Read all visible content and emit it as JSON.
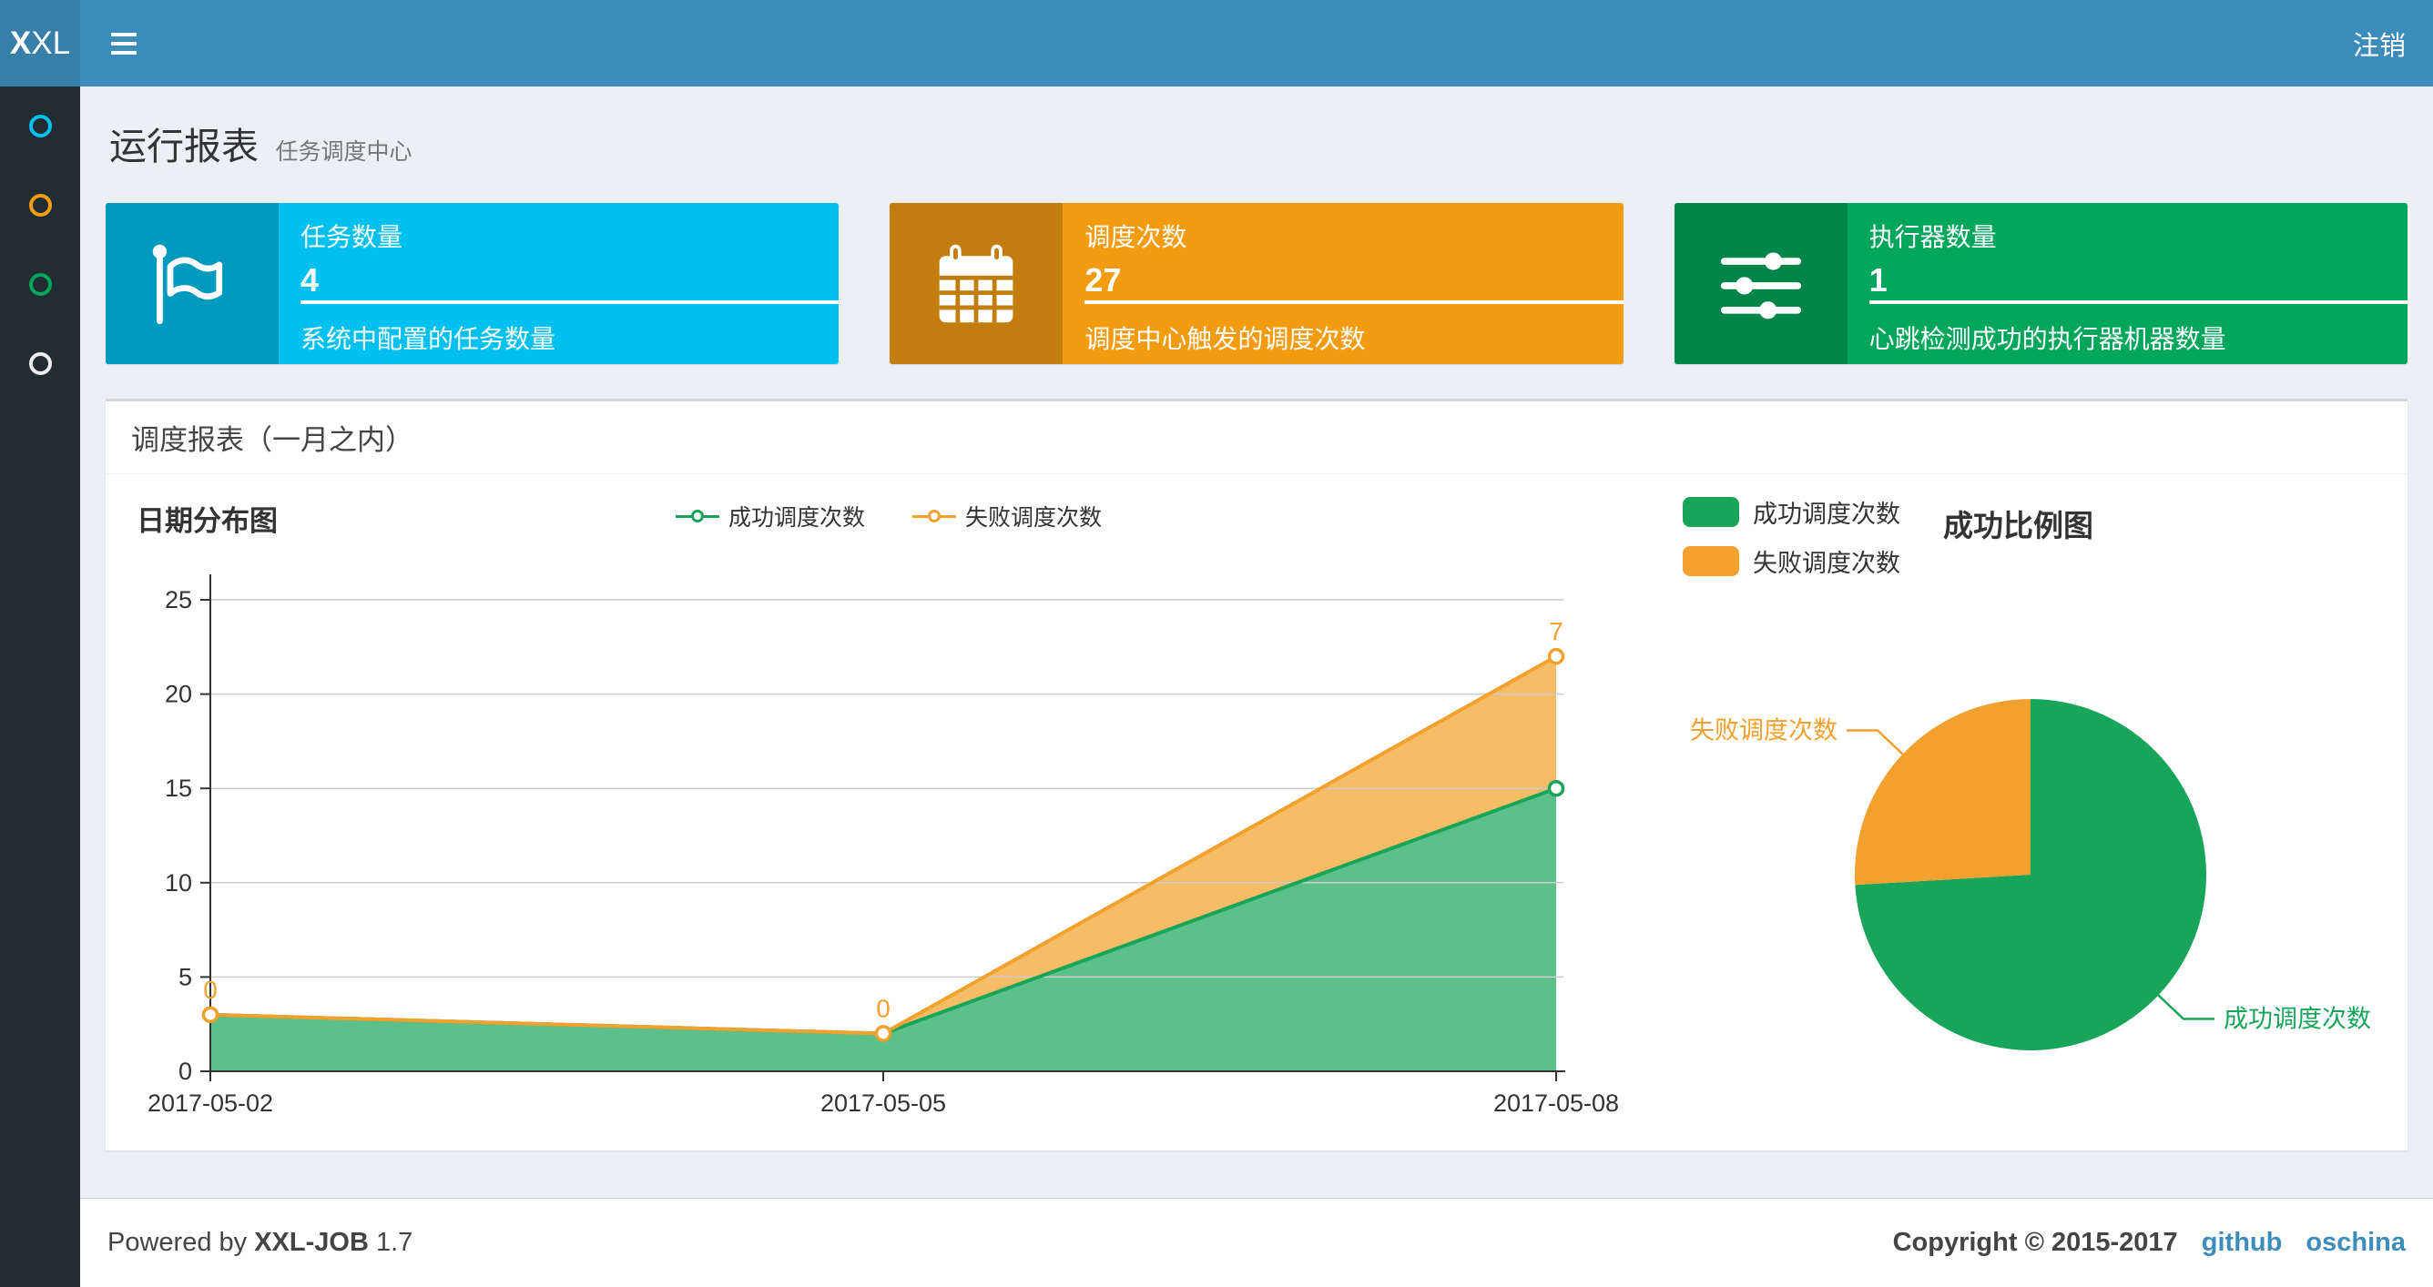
{
  "navbar": {
    "logo_bold": "X",
    "logo_light": "XL",
    "logout_label": "注销"
  },
  "sidebar": {
    "items": [
      {
        "icon": "circle-icon",
        "color": "#00c0ef"
      },
      {
        "icon": "circle-icon",
        "color": "#f39c12"
      },
      {
        "icon": "circle-icon",
        "color": "#00a65a"
      },
      {
        "icon": "circle-icon",
        "color": "#eeeeee"
      }
    ]
  },
  "page_header": {
    "title": "运行报表",
    "subtitle": "任务调度中心"
  },
  "info_boxes": [
    {
      "icon": "flag-icon",
      "label": "任务数量",
      "value": "4",
      "desc": "系统中配置的任务数量",
      "color": "#00c0ef",
      "icon_bg": "#009abf"
    },
    {
      "icon": "calendar-icon",
      "label": "调度次数",
      "value": "27",
      "desc": "调度中心触发的调度次数",
      "color": "#f39c12",
      "icon_bg": "#c27d0e"
    },
    {
      "icon": "sliders-icon",
      "label": "执行器数量",
      "value": "1",
      "desc": "心跳检测成功的执行器机器数量",
      "color": "#00a65a",
      "icon_bg": "#008548"
    }
  ],
  "panel": {
    "title": "调度报表（一月之内）"
  },
  "chart_data": [
    {
      "type": "area",
      "title": "日期分布图",
      "x": [
        "2017-05-02",
        "2017-05-05",
        "2017-05-08"
      ],
      "stacked": true,
      "ylim": [
        0,
        25
      ],
      "yticks": [
        0,
        5,
        10,
        15,
        20,
        25
      ],
      "grid": true,
      "legend_position": "top",
      "series": [
        {
          "name": "成功调度次数",
          "values": [
            3,
            2,
            15
          ],
          "color": "#18a55a",
          "fill": "#5bc089",
          "show_labels": false
        },
        {
          "name": "失败调度次数",
          "values": [
            0,
            0,
            7
          ],
          "color": "#f2a12f",
          "fill": "#f6bd66",
          "show_labels": true
        }
      ]
    },
    {
      "type": "pie",
      "title": "成功比例图",
      "start_angle": "top",
      "direction": "clockwise",
      "legend_position": "top-left",
      "slices": [
        {
          "name": "成功调度次数",
          "value": 20,
          "color": "#18a55a"
        },
        {
          "name": "失败调度次数",
          "value": 7,
          "color": "#f2a12f"
        }
      ]
    }
  ],
  "footer": {
    "powered_prefix": "Powered by",
    "product": "XXL-JOB",
    "version": "1.7",
    "copyright": "Copyright © 2015-2017",
    "links": [
      "github",
      "oschina"
    ]
  }
}
